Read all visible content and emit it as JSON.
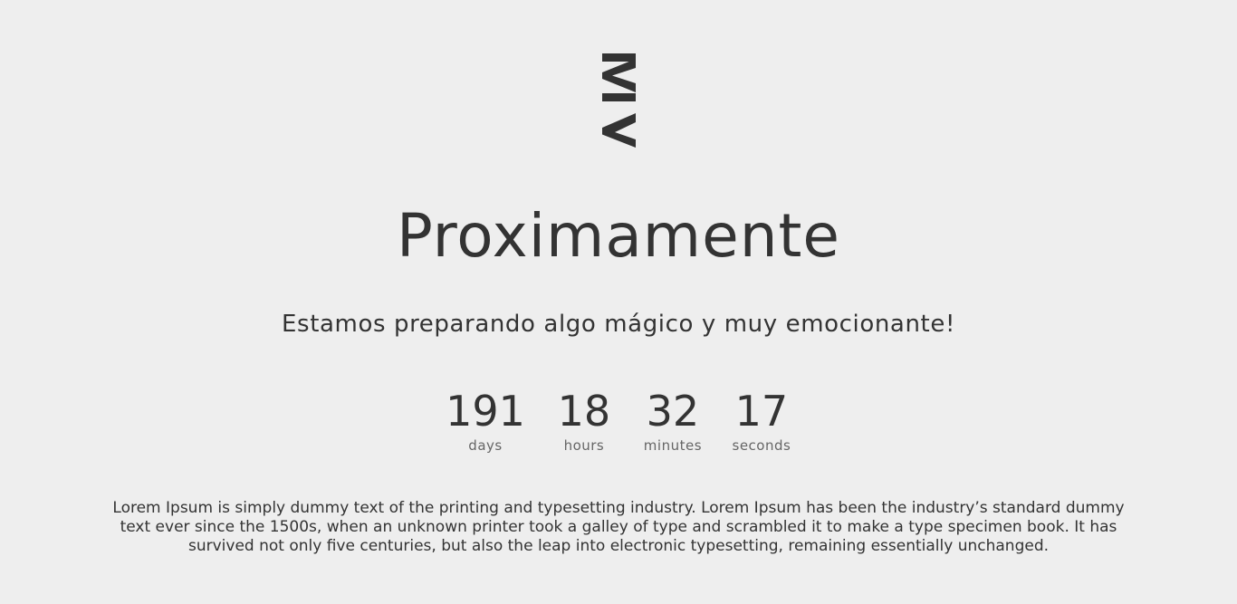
{
  "logo": {
    "icon": "brand-logo-icon",
    "color": "#333333"
  },
  "hero": {
    "title": "Proximamente",
    "subtitle": "Estamos preparando algo mágico y muy emocionante!"
  },
  "countdown": {
    "days": {
      "value": "191",
      "label": "days"
    },
    "hours": {
      "value": "18",
      "label": "hours"
    },
    "minutes": {
      "value": "32",
      "label": "minutes"
    },
    "seconds": {
      "value": "17",
      "label": "seconds"
    }
  },
  "description": "Lorem Ipsum is simply dummy text of the printing and typesetting industry. Lorem Ipsum has been the industry’s standard dummy text ever since the 1500s, when an unknown printer took a galley of type and scrambled it to make a type specimen book. It has survived not only five centuries, but also the leap into electronic typesetting, remaining essentially unchanged.",
  "colors": {
    "background": "#eeeeee",
    "text": "#333333",
    "muted": "#666666"
  }
}
